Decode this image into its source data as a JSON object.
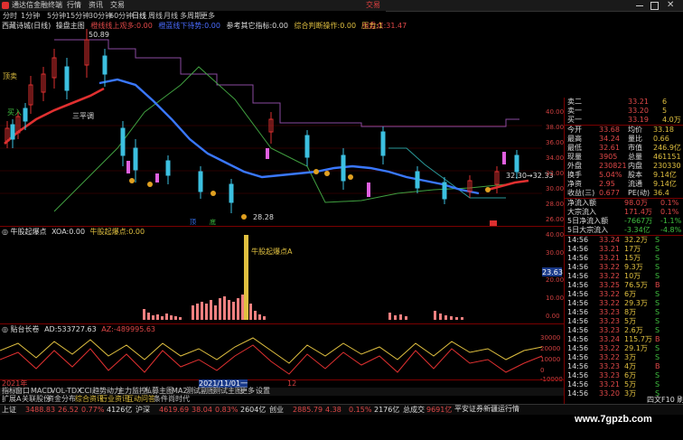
{
  "app": {
    "name": "通达信金融终端",
    "top_menus": [
      "行情",
      "资讯",
      "交易"
    ],
    "title_right": "交易"
  },
  "period_tabs": [
    "分时",
    "1分钟",
    "5分钟",
    "15分钟",
    "30分钟",
    "60分钟",
    "日线",
    "周线",
    "月线",
    "多周期",
    "更多"
  ],
  "main_header": {
    "name": "西藏诗城(日线)",
    "indicator": "操盘主图",
    "items": [
      "橙线线上观多:0.00",
      "橙蓝线下待势:0.00",
      "参考其它指标:0.00",
      "综合判断操作:0.00"
    ],
    "extra": "强盘点:31.47",
    "right": "压力:1"
  },
  "price_labels": {
    "high": "50.89",
    "low": "28.28",
    "mid": "32.30→32.33",
    "tag_top": "顶卖",
    "tag_buy": "买入",
    "tag_sell": "三平调",
    "bottom_tags": [
      "顶",
      "底"
    ]
  },
  "main_axis": [
    "40.00",
    "38.00",
    "36.00",
    "34.00",
    "32.00",
    "30.00",
    "28.00",
    "26.00"
  ],
  "vol_header": {
    "name": "牛股起爆点",
    "items": [
      "XOA:0.00",
      "牛股起爆点:0.00"
    ]
  },
  "vol_annotation": "牛股起爆点A",
  "vol_axis": [
    "40.00",
    "30.00",
    "20.00",
    "10.00",
    "0.00"
  ],
  "vol_box": "23.63",
  "ad_header": {
    "name": "贴台长卷",
    "items": [
      "AD:533727.63",
      "AZ:-489995.63"
    ]
  },
  "ad_axis": [
    "30000",
    "20000",
    "10000",
    "0",
    "-10000"
  ],
  "date_labels": [
    "2021年",
    "2021/11/01一",
    "12"
  ],
  "quote": {
    "orderbook": [
      {
        "label": "卖二",
        "price": "33.21",
        "vol": "6"
      },
      {
        "label": "卖一",
        "price": "33.20",
        "vol": "5"
      },
      {
        "label": "买一",
        "price": "33.19",
        "vol": "4.0万"
      }
    ],
    "stats": [
      {
        "k1": "今开",
        "v1": "33.68",
        "k2": "均价",
        "v2": "33.18"
      },
      {
        "k1": "最高",
        "v1": "34.24",
        "k2": "量比",
        "v2": "0.66"
      },
      {
        "k1": "最低",
        "v1": "32.61",
        "k2": "市值",
        "v2": "246.9亿"
      },
      {
        "k1": "现量",
        "v1": "3905",
        "k2": "总量",
        "v2": "461151"
      },
      {
        "k1": "外盘",
        "v1": "230821",
        "k2": "内盘",
        "v2": "230330"
      },
      {
        "k1": "换手",
        "v1": "5.04%",
        "k2": "股本",
        "v2": "9.14亿"
      },
      {
        "k1": "净资",
        "v1": "2.95",
        "k2": "流通",
        "v2": "9.14亿"
      },
      {
        "k1": "收益(三)",
        "v1": "0.677",
        "k2": "PE(动)",
        "v2": "36.4"
      }
    ],
    "flows": [
      {
        "k": "净流入额",
        "v": "98.0万",
        "v2": "0.1%"
      },
      {
        "k": "大宗流入",
        "v": "171.4万",
        "v2": "0.1%"
      },
      {
        "k": "5日净流入额",
        "v": "-7667万",
        "v2": "-1.1%"
      },
      {
        "k": "5日大宗流入",
        "v": "-3.34亿",
        "v2": "-4.8%"
      }
    ],
    "ticks": [
      {
        "t": "14:56",
        "p": "33.24",
        "v": "32.2万",
        "s": "S"
      },
      {
        "t": "14:56",
        "p": "33.21",
        "v": "17万",
        "s": "S"
      },
      {
        "t": "14:56",
        "p": "33.21",
        "v": "15万",
        "s": "S"
      },
      {
        "t": "14:56",
        "p": "33.22",
        "v": "9.3万",
        "s": "S"
      },
      {
        "t": "14:56",
        "p": "33.22",
        "v": "10万",
        "s": "S"
      },
      {
        "t": "14:56",
        "p": "33.25",
        "v": "76.5万",
        "s": "B"
      },
      {
        "t": "14:56",
        "p": "33.22",
        "v": "6万",
        "s": "S"
      },
      {
        "t": "14:56",
        "p": "33.22",
        "v": "29.3万",
        "s": "S"
      },
      {
        "t": "14:56",
        "p": "33.23",
        "v": "8万",
        "s": "S"
      },
      {
        "t": "14:56",
        "p": "33.23",
        "v": "5万",
        "s": "S"
      },
      {
        "t": "14:56",
        "p": "33.23",
        "v": "2.6万",
        "s": "S"
      },
      {
        "t": "14:56",
        "p": "33.24",
        "v": "115.7万",
        "s": "B"
      },
      {
        "t": "14:56",
        "p": "33.22",
        "v": "29.1万",
        "s": "S"
      },
      {
        "t": "14:56",
        "p": "33.22",
        "v": "3万",
        "s": "S"
      },
      {
        "t": "14:56",
        "p": "33.23",
        "v": "4万",
        "s": "B"
      },
      {
        "t": "14:56",
        "p": "33.23",
        "v": "6万",
        "s": "S"
      },
      {
        "t": "14:56",
        "p": "33.21",
        "v": "5万",
        "s": "S"
      },
      {
        "t": "14:56",
        "p": "33.20",
        "v": "3万",
        "s": "S"
      }
    ]
  },
  "bottom_tabs": [
    "指标",
    "窗口",
    "MACD",
    "VOL-TDX",
    "CCI",
    "趋势动力",
    "主力监控",
    "私募主图",
    "MA2",
    "测试副图",
    "测试主图",
    "更多",
    "设置"
  ],
  "bottom_tabs2": [
    "扩展A",
    "关联股份",
    "资金分布",
    "综合资讯",
    "行业资讯",
    "互动问答",
    "条件尚时代"
  ],
  "status": [
    {
      "name": "上证",
      "val": "3488.83",
      "chg": "26.52",
      "pct": "0.77%",
      "amt": "4126亿"
    },
    {
      "name": "沪深",
      "val": "4619.69",
      "chg": "38.04",
      "pct": "0.83%",
      "amt": "2604亿"
    },
    {
      "name": "创业",
      "val": "2885.79",
      "chg": "4.38",
      "pct": "0.15%",
      "amt": "2176亿"
    },
    {
      "name": "总成交",
      "val": "9691亿"
    }
  ],
  "status_right": "平安证券新疆运行情",
  "watermark": "www.7gpzb.com",
  "corner_label": "四文F10 刷新"
}
